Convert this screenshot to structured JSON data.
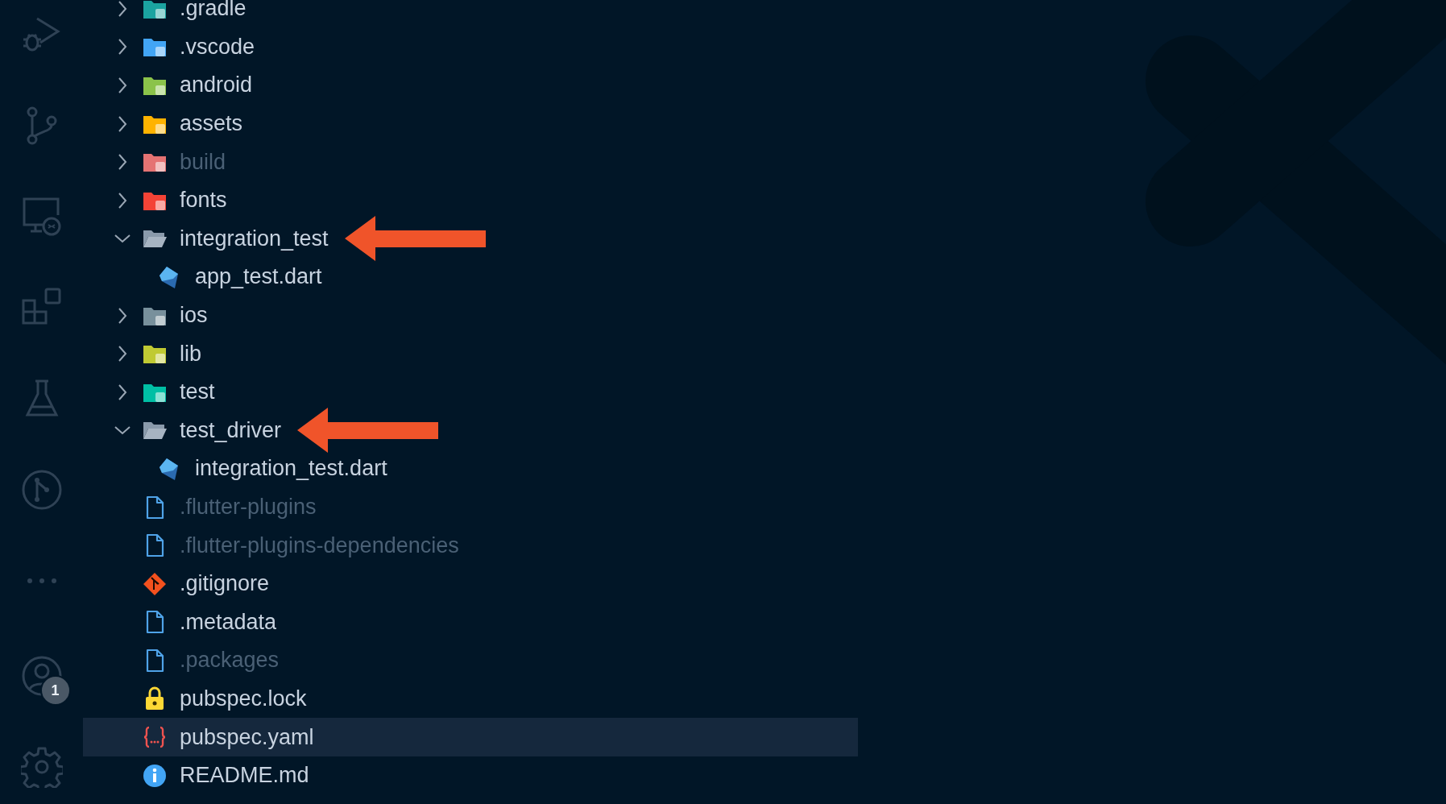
{
  "activity_bar": {
    "accounts_badge": "1"
  },
  "explorer": {
    "items": [
      {
        "kind": "folder",
        "label": ".gradle",
        "expanded": false,
        "dimmed": false,
        "selected": false,
        "annotated": false
      },
      {
        "kind": "folder",
        "label": ".vscode",
        "expanded": false,
        "dimmed": false,
        "selected": false,
        "annotated": false
      },
      {
        "kind": "folder",
        "label": "android",
        "expanded": false,
        "dimmed": false,
        "selected": false,
        "annotated": false
      },
      {
        "kind": "folder",
        "label": "assets",
        "expanded": false,
        "dimmed": false,
        "selected": false,
        "annotated": false
      },
      {
        "kind": "folder",
        "label": "build",
        "expanded": false,
        "dimmed": true,
        "selected": false,
        "annotated": false
      },
      {
        "kind": "folder",
        "label": "fonts",
        "expanded": false,
        "dimmed": false,
        "selected": false,
        "annotated": false
      },
      {
        "kind": "folder",
        "label": "integration_test",
        "expanded": true,
        "dimmed": false,
        "selected": false,
        "annotated": true,
        "children": [
          {
            "kind": "file",
            "label": "app_test.dart",
            "dimmed": false,
            "selected": false,
            "annotated": false
          }
        ]
      },
      {
        "kind": "folder",
        "label": "ios",
        "expanded": false,
        "dimmed": false,
        "selected": false,
        "annotated": false
      },
      {
        "kind": "folder",
        "label": "lib",
        "expanded": false,
        "dimmed": false,
        "selected": false,
        "annotated": false
      },
      {
        "kind": "folder",
        "label": "test",
        "expanded": false,
        "dimmed": false,
        "selected": false,
        "annotated": false
      },
      {
        "kind": "folder",
        "label": "test_driver",
        "expanded": true,
        "dimmed": false,
        "selected": false,
        "annotated": true,
        "children": [
          {
            "kind": "file",
            "label": "integration_test.dart",
            "dimmed": false,
            "selected": false,
            "annotated": false
          }
        ]
      },
      {
        "kind": "file",
        "label": ".flutter-plugins",
        "dimmed": true,
        "selected": false,
        "annotated": false
      },
      {
        "kind": "file",
        "label": ".flutter-plugins-dependencies",
        "dimmed": true,
        "selected": false,
        "annotated": false
      },
      {
        "kind": "file",
        "label": ".gitignore",
        "dimmed": false,
        "selected": false,
        "annotated": false
      },
      {
        "kind": "file",
        "label": ".metadata",
        "dimmed": false,
        "selected": false,
        "annotated": false
      },
      {
        "kind": "file",
        "label": ".packages",
        "dimmed": true,
        "selected": false,
        "annotated": false
      },
      {
        "kind": "file",
        "label": "pubspec.lock",
        "dimmed": false,
        "selected": false,
        "annotated": false
      },
      {
        "kind": "file",
        "label": "pubspec.yaml",
        "dimmed": false,
        "selected": true,
        "annotated": false
      },
      {
        "kind": "file",
        "label": "README.md",
        "dimmed": false,
        "selected": false,
        "annotated": false
      }
    ]
  }
}
